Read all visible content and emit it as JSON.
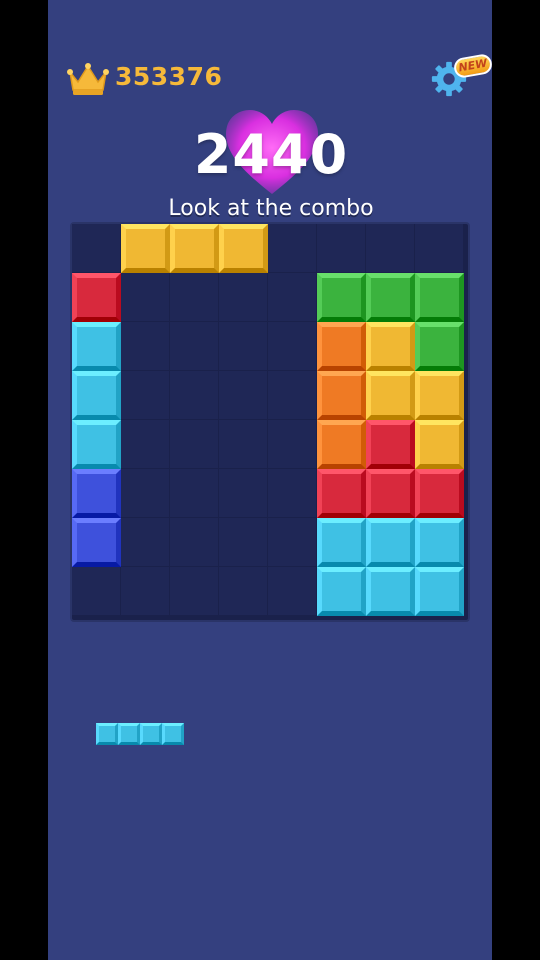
{
  "header": {
    "best_score": "353376",
    "crown_icon": "crown-icon",
    "settings_icon": "gear-icon",
    "new_badge": "NEW"
  },
  "current_score": "2440",
  "combo_message": "Look at the combo",
  "colors": {
    "background": "#34407f",
    "board": "#1a214b",
    "Y": "#f0b833",
    "R": "#d8293d",
    "C": "#3fc1e4",
    "B": "#3e51dc",
    "G": "#3bb33e",
    "O": "#ef7a24"
  },
  "board": {
    "rows": 8,
    "cols": 8,
    "grid": [
      ".YYY....",
      "R....GGG",
      "C....OYG",
      "C....OYY",
      "C....ORY",
      "B....RRR",
      "B....CCC",
      ".....CCC"
    ]
  },
  "tray": {
    "pieces": [
      {
        "color": "C",
        "shape": "1x4"
      }
    ]
  }
}
